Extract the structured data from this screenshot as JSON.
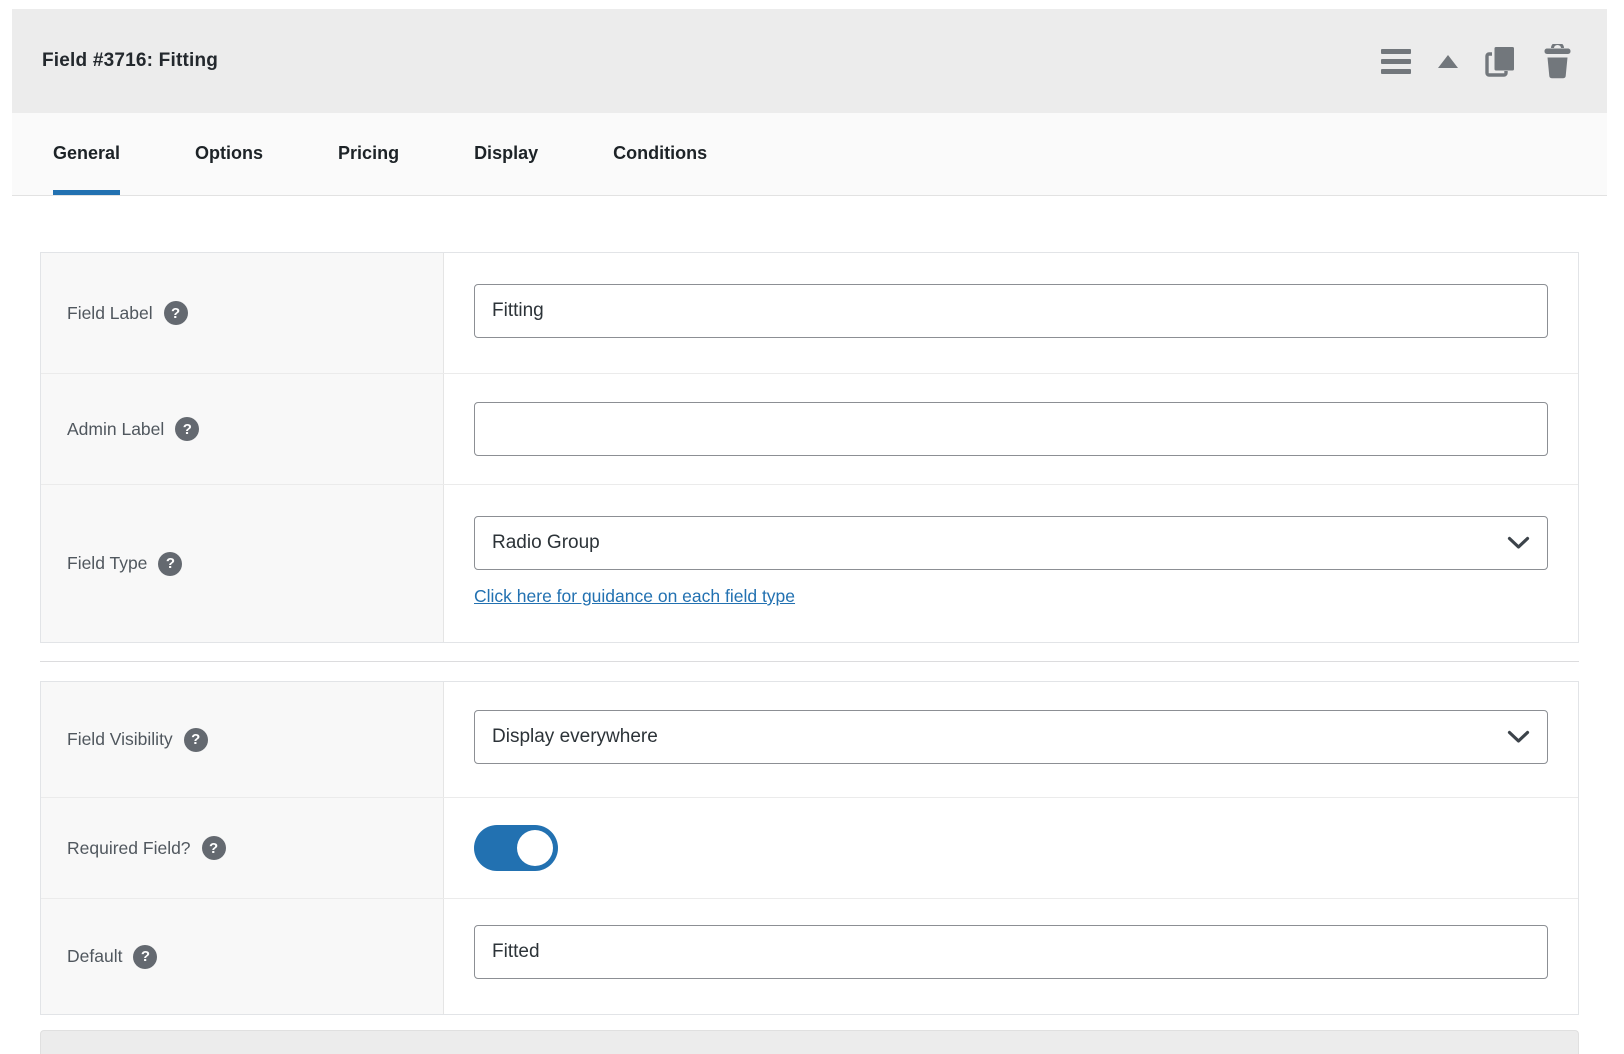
{
  "header": {
    "title": "Field #3716: Fitting",
    "icons": [
      "drag-handle-icon",
      "collapse-icon",
      "duplicate-icon",
      "delete-icon"
    ]
  },
  "icons": {
    "help_glyph": "?"
  },
  "tabs": {
    "items": [
      {
        "label": "General",
        "active": true
      },
      {
        "label": "Options",
        "active": false
      },
      {
        "label": "Pricing",
        "active": false
      },
      {
        "label": "Display",
        "active": false
      },
      {
        "label": "Conditions",
        "active": false
      }
    ]
  },
  "form": {
    "field_label": {
      "label": "Field Label",
      "value": "Fitting"
    },
    "admin_label": {
      "label": "Admin Label",
      "value": ""
    },
    "field_type": {
      "label": "Field Type",
      "value": "Radio Group",
      "link": "Click here for guidance on each field type"
    },
    "field_visibility": {
      "label": "Field Visibility",
      "value": "Display everywhere"
    },
    "required": {
      "label": "Required Field?",
      "state": "on"
    },
    "default": {
      "label": "Default",
      "value": "Fitted"
    }
  },
  "colors": {
    "accent_blue": "#2271b1",
    "header_bg": "#ececec",
    "icon_gray": "#72777c",
    "toggle_on": "#2271b1"
  }
}
